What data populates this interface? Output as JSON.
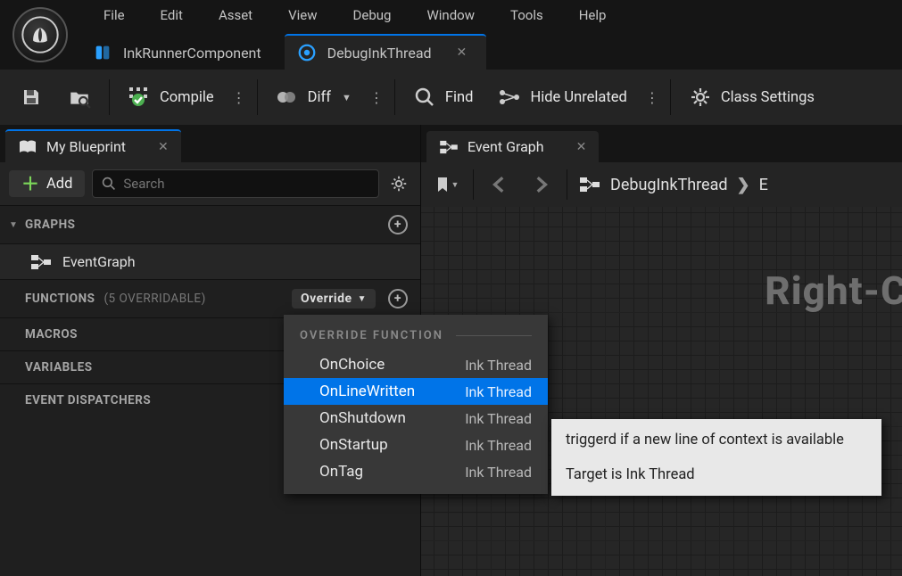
{
  "menu": {
    "items": [
      "File",
      "Edit",
      "Asset",
      "View",
      "Debug",
      "Window",
      "Tools",
      "Help"
    ]
  },
  "doc_tabs": [
    {
      "label": "InkRunnerComponent",
      "active": false
    },
    {
      "label": "DebugInkThread",
      "active": true
    }
  ],
  "toolbar": {
    "compile": "Compile",
    "diff": "Diff",
    "find": "Find",
    "hide_unrelated": "Hide Unrelated",
    "class_settings": "Class Settings"
  },
  "blueprint_panel": {
    "title": "My Blueprint",
    "add": "Add",
    "search_placeholder": "Search",
    "sections": {
      "graphs": {
        "label": "GRAPHS",
        "items": [
          "EventGraph"
        ]
      },
      "functions": {
        "label": "FUNCTIONS",
        "suffix": "(5 OVERRIDABLE)",
        "override_btn": "Override"
      },
      "macros": {
        "label": "MACROS"
      },
      "variables": {
        "label": "VARIABLES"
      },
      "event_dispatchers": {
        "label": "EVENT DISPATCHERS"
      }
    }
  },
  "event_graph": {
    "tab": "Event Graph",
    "breadcrumb": {
      "root": "DebugInkThread",
      "next_initial": "E"
    },
    "hint": "Right-C"
  },
  "override_popup": {
    "title": "OVERRIDE FUNCTION",
    "items": [
      {
        "name": "OnChoice",
        "src": "Ink Thread",
        "selected": false
      },
      {
        "name": "OnLineWritten",
        "src": "Ink Thread",
        "selected": true
      },
      {
        "name": "OnShutdown",
        "src": "Ink Thread",
        "selected": false
      },
      {
        "name": "OnStartup",
        "src": "Ink Thread",
        "selected": false
      },
      {
        "name": "OnTag",
        "src": "Ink Thread",
        "selected": false
      }
    ]
  },
  "tooltip": {
    "line1": "triggerd if a new line of context is available",
    "line2": "Target is Ink Thread"
  }
}
